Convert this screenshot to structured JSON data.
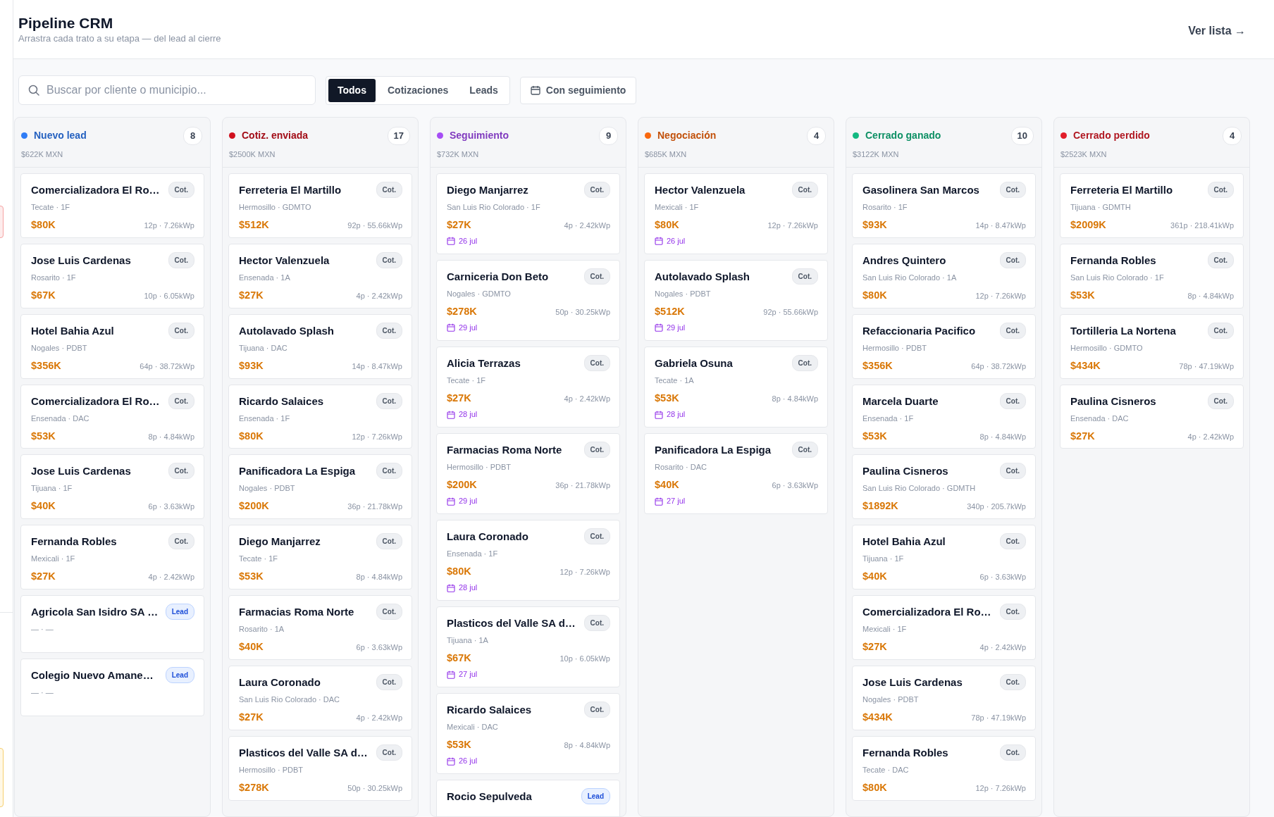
{
  "header": {
    "title": "Pipeline CRM",
    "subtitle": "Arrastra cada trato a su etapa — del lead al cierre",
    "view_link": "Ver lista →"
  },
  "toolbar": {
    "search": {
      "placeholder": "Buscar por cliente o municipio..."
    },
    "tabs": [
      {
        "label": "Todos",
        "selected": true
      },
      {
        "label": "Cotizaciones",
        "selected": false
      },
      {
        "label": "Leads",
        "selected": false
      }
    ],
    "follow_up_button": "Con seguimiento"
  },
  "columns": [
    {
      "title": "Nuevo lead",
      "color": "#2f7cf6",
      "count": "8",
      "total": "$622K MXN",
      "cards": [
        {
          "kind": "quote",
          "name": "Comercializadora El Ro…",
          "tag": "Cot.",
          "meta": "Tecate · 1F",
          "amount": "$80K",
          "specs": "12p · 7.26kWp"
        },
        {
          "kind": "quote",
          "name": "Jose Luis Cardenas",
          "tag": "Cot.",
          "meta": "Rosarito · 1F",
          "amount": "$67K",
          "specs": "10p · 6.05kWp"
        },
        {
          "kind": "quote",
          "name": "Hotel Bahia Azul",
          "tag": "Cot.",
          "meta": "Nogales · PDBT",
          "amount": "$356K",
          "specs": "64p · 38.72kWp"
        },
        {
          "kind": "quote",
          "name": "Comercializadora El Ro…",
          "tag": "Cot.",
          "meta": "Ensenada · DAC",
          "amount": "$53K",
          "specs": "8p · 4.84kWp"
        },
        {
          "kind": "quote",
          "name": "Jose Luis Cardenas",
          "tag": "Cot.",
          "meta": "Tijuana · 1F",
          "amount": "$40K",
          "specs": "6p · 3.63kWp"
        },
        {
          "kind": "quote",
          "name": "Fernanda Robles",
          "tag": "Cot.",
          "meta": "Mexicali · 1F",
          "amount": "$27K",
          "specs": "4p · 2.42kWp"
        },
        {
          "kind": "lead",
          "name": "Agricola San Isidro SA …",
          "tag": "Lead",
          "meta": "— · —"
        },
        {
          "kind": "lead",
          "name": "Colegio Nuevo Amane…",
          "tag": "Lead",
          "meta": "— · —"
        }
      ]
    },
    {
      "title": "Cotiz. enviada",
      "color": "#d0101e",
      "count": "17",
      "total": "$2500K MXN",
      "cards": [
        {
          "kind": "quote",
          "name": "Ferreteria El Martillo",
          "tag": "Cot.",
          "meta": "Hermosillo · GDMTO",
          "amount": "$512K",
          "specs": "92p · 55.66kWp"
        },
        {
          "kind": "quote",
          "name": "Hector Valenzuela",
          "tag": "Cot.",
          "meta": "Ensenada · 1A",
          "amount": "$27K",
          "specs": "4p · 2.42kWp"
        },
        {
          "kind": "quote",
          "name": "Autolavado Splash",
          "tag": "Cot.",
          "meta": "Tijuana · DAC",
          "amount": "$93K",
          "specs": "14p · 8.47kWp"
        },
        {
          "kind": "quote",
          "name": "Ricardo Salaices",
          "tag": "Cot.",
          "meta": "Ensenada · 1F",
          "amount": "$80K",
          "specs": "12p · 7.26kWp"
        },
        {
          "kind": "quote",
          "name": "Panificadora La Espiga",
          "tag": "Cot.",
          "meta": "Nogales · PDBT",
          "amount": "$200K",
          "specs": "36p · 21.78kWp"
        },
        {
          "kind": "quote",
          "name": "Diego Manjarrez",
          "tag": "Cot.",
          "meta": "Tecate · 1F",
          "amount": "$53K",
          "specs": "8p · 4.84kWp"
        },
        {
          "kind": "quote",
          "name": "Farmacias Roma Norte",
          "tag": "Cot.",
          "meta": "Rosarito · 1A",
          "amount": "$40K",
          "specs": "6p · 3.63kWp"
        },
        {
          "kind": "quote",
          "name": "Laura Coronado",
          "tag": "Cot.",
          "meta": "San Luis Rio Colorado · DAC",
          "amount": "$27K",
          "specs": "4p · 2.42kWp"
        },
        {
          "kind": "quote",
          "name": "Plasticos del Valle SA d…",
          "tag": "Cot.",
          "meta": "Hermosillo · PDBT",
          "amount": "$278K",
          "specs": "50p · 30.25kWp"
        }
      ]
    },
    {
      "title": "Seguimiento",
      "color": "#a64df5",
      "count": "9",
      "total": "$732K MXN",
      "cards": [
        {
          "kind": "quote",
          "name": "Diego Manjarrez",
          "tag": "Cot.",
          "meta": "San Luis Rio Colorado · 1F",
          "amount": "$27K",
          "specs": "4p · 2.42kWp",
          "date": "26 jul"
        },
        {
          "kind": "quote",
          "name": "Carniceria Don Beto",
          "tag": "Cot.",
          "meta": "Nogales · GDMTO",
          "amount": "$278K",
          "specs": "50p · 30.25kWp",
          "date": "29 jul"
        },
        {
          "kind": "quote",
          "name": "Alicia Terrazas",
          "tag": "Cot.",
          "meta": "Tecate · 1F",
          "amount": "$27K",
          "specs": "4p · 2.42kWp",
          "date": "28 jul"
        },
        {
          "kind": "quote",
          "name": "Farmacias Roma Norte",
          "tag": "Cot.",
          "meta": "Hermosillo · PDBT",
          "amount": "$200K",
          "specs": "36p · 21.78kWp",
          "date": "29 jul"
        },
        {
          "kind": "quote",
          "name": "Laura Coronado",
          "tag": "Cot.",
          "meta": "Ensenada · 1F",
          "amount": "$80K",
          "specs": "12p · 7.26kWp",
          "date": "28 jul"
        },
        {
          "kind": "quote",
          "name": "Plasticos del Valle SA d…",
          "tag": "Cot.",
          "meta": "Tijuana · 1A",
          "amount": "$67K",
          "specs": "10p · 6.05kWp",
          "date": "27 jul"
        },
        {
          "kind": "quote",
          "name": "Ricardo Salaices",
          "tag": "Cot.",
          "meta": "Mexicali · DAC",
          "amount": "$53K",
          "specs": "8p · 4.84kWp",
          "date": "26 jul"
        },
        {
          "kind": "lead",
          "name": "Rocio Sepulveda",
          "tag": "Lead"
        }
      ]
    },
    {
      "title": "Negociación",
      "color": "#f9680e",
      "count": "4",
      "total": "$685K MXN",
      "cards": [
        {
          "kind": "quote",
          "name": "Hector Valenzuela",
          "tag": "Cot.",
          "meta": "Mexicali · 1F",
          "amount": "$80K",
          "specs": "12p · 7.26kWp",
          "date": "26 jul"
        },
        {
          "kind": "quote",
          "name": "Autolavado Splash",
          "tag": "Cot.",
          "meta": "Nogales · PDBT",
          "amount": "$512K",
          "specs": "92p · 55.66kWp",
          "date": "29 jul"
        },
        {
          "kind": "quote",
          "name": "Gabriela Osuna",
          "tag": "Cot.",
          "meta": "Tecate · 1A",
          "amount": "$53K",
          "specs": "8p · 4.84kWp",
          "date": "28 jul"
        },
        {
          "kind": "quote",
          "name": "Panificadora La Espiga",
          "tag": "Cot.",
          "meta": "Rosarito · DAC",
          "amount": "$40K",
          "specs": "6p · 3.63kWp",
          "date": "27 jul"
        }
      ]
    },
    {
      "title": "Cerrado ganado",
      "color": "#12b981",
      "count": "10",
      "total": "$3122K MXN",
      "cards": [
        {
          "kind": "quote",
          "name": "Gasolinera San Marcos",
          "tag": "Cot.",
          "meta": "Rosarito · 1F",
          "amount": "$93K",
          "specs": "14p · 8.47kWp"
        },
        {
          "kind": "quote",
          "name": "Andres Quintero",
          "tag": "Cot.",
          "meta": "San Luis Rio Colorado · 1A",
          "amount": "$80K",
          "specs": "12p · 7.26kWp"
        },
        {
          "kind": "quote",
          "name": "Refaccionaria Pacifico",
          "tag": "Cot.",
          "meta": "Hermosillo · PDBT",
          "amount": "$356K",
          "specs": "64p · 38.72kWp"
        },
        {
          "kind": "quote",
          "name": "Marcela Duarte",
          "tag": "Cot.",
          "meta": "Ensenada · 1F",
          "amount": "$53K",
          "specs": "8p · 4.84kWp"
        },
        {
          "kind": "quote",
          "name": "Paulina Cisneros",
          "tag": "Cot.",
          "meta": "San Luis Rio Colorado · GDMTH",
          "amount": "$1892K",
          "specs": "340p · 205.7kWp"
        },
        {
          "kind": "quote",
          "name": "Hotel Bahia Azul",
          "tag": "Cot.",
          "meta": "Tijuana · 1F",
          "amount": "$40K",
          "specs": "6p · 3.63kWp"
        },
        {
          "kind": "quote",
          "name": "Comercializadora El Ro…",
          "tag": "Cot.",
          "meta": "Mexicali · 1F",
          "amount": "$27K",
          "specs": "4p · 2.42kWp"
        },
        {
          "kind": "quote",
          "name": "Jose Luis Cardenas",
          "tag": "Cot.",
          "meta": "Nogales · PDBT",
          "amount": "$434K",
          "specs": "78p · 47.19kWp"
        },
        {
          "kind": "quote",
          "name": "Fernanda Robles",
          "tag": "Cot.",
          "meta": "Tecate · DAC",
          "amount": "$80K",
          "specs": "12p · 7.26kWp"
        }
      ]
    },
    {
      "title": "Cerrado perdido",
      "color": "#e11d2a",
      "count": "4",
      "total": "$2523K MXN",
      "cards": [
        {
          "kind": "quote",
          "name": "Ferreteria El Martillo",
          "tag": "Cot.",
          "meta": "Tijuana · GDMTH",
          "amount": "$2009K",
          "specs": "361p · 218.41kWp"
        },
        {
          "kind": "quote",
          "name": "Fernanda Robles",
          "tag": "Cot.",
          "meta": "San Luis Rio Colorado · 1F",
          "amount": "$53K",
          "specs": "8p · 4.84kWp"
        },
        {
          "kind": "quote",
          "name": "Tortilleria La Nortena",
          "tag": "Cot.",
          "meta": "Hermosillo · GDMTO",
          "amount": "$434K",
          "specs": "78p · 47.19kWp"
        },
        {
          "kind": "quote",
          "name": "Paulina Cisneros",
          "tag": "Cot.",
          "meta": "Ensenada · DAC",
          "amount": "$27K",
          "specs": "4p · 2.42kWp"
        }
      ]
    }
  ]
}
